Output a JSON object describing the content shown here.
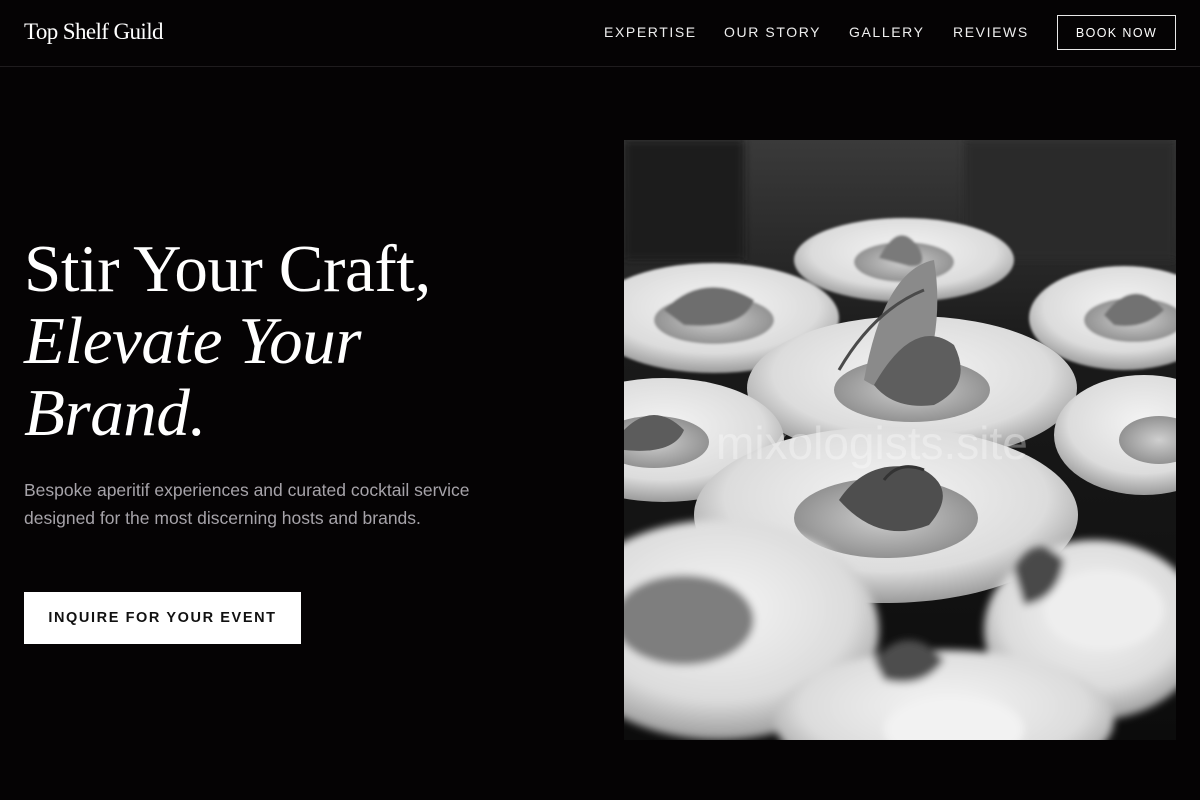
{
  "header": {
    "brand": "Top Shelf Guild",
    "nav": {
      "expertise": "EXPERTISE",
      "our_story": "OUR STORY",
      "gallery": "GALLERY",
      "reviews": "REVIEWS"
    },
    "book_now_label": "BOOK NOW"
  },
  "hero": {
    "title_line_1": "Stir Your Craft,",
    "title_line_2": "Elevate Your",
    "title_line_3": "Brand.",
    "subtitle": "Bespoke aperitif experiences and curated cocktail service designed for the most discerning hosts and brands.",
    "cta_label": "INQUIRE FOR YOUR EVENT",
    "image": {
      "subject": "black-and-white photo of plated appetizers in white bowls",
      "watermark": "mixologists.site"
    }
  },
  "colors": {
    "background": "#050304",
    "text": "#ffffff",
    "muted_text": "#a6a3a9",
    "button_bg": "#ffffff",
    "button_text": "#111111"
  }
}
